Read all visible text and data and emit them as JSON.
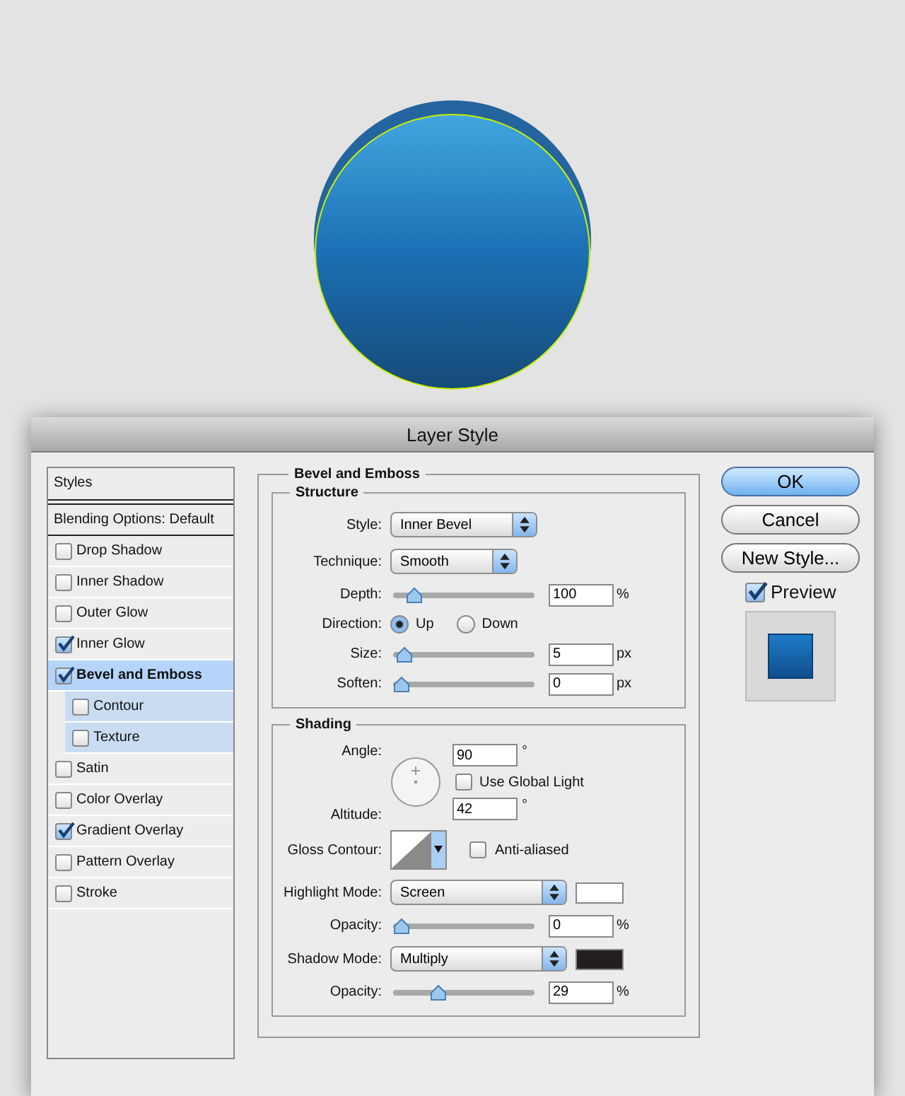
{
  "dialog": {
    "title": "Layer Style"
  },
  "styles": {
    "header": "Styles",
    "blending": "Blending Options: Default",
    "items": [
      {
        "label": "Drop Shadow",
        "checked": false,
        "selected": false
      },
      {
        "label": "Inner Shadow",
        "checked": false,
        "selected": false
      },
      {
        "label": "Outer Glow",
        "checked": false,
        "selected": false
      },
      {
        "label": "Inner Glow",
        "checked": true,
        "selected": false
      },
      {
        "label": "Bevel and Emboss",
        "checked": true,
        "selected": true,
        "children": [
          {
            "label": "Contour",
            "checked": false,
            "selected": false
          },
          {
            "label": "Texture",
            "checked": false,
            "selected": false
          }
        ]
      },
      {
        "label": "Satin",
        "checked": false,
        "selected": false
      },
      {
        "label": "Color Overlay",
        "checked": false,
        "selected": false
      },
      {
        "label": "Gradient Overlay",
        "checked": true,
        "selected": false
      },
      {
        "label": "Pattern Overlay",
        "checked": false,
        "selected": false
      },
      {
        "label": "Stroke",
        "checked": false,
        "selected": false
      }
    ]
  },
  "panel": {
    "title": "Bevel and Emboss",
    "structure": {
      "title": "Structure",
      "rows": [
        {
          "kind": "dropdown",
          "label": "Style:",
          "value": "Inner Bevel"
        },
        {
          "kind": "dropdown",
          "label": "Technique:",
          "value": "Smooth"
        },
        {
          "kind": "slider",
          "label": "Depth:",
          "level": 0.1,
          "value": "100",
          "unit": "%"
        },
        {
          "kind": "radio",
          "label": "Direction:",
          "options": [
            {
              "label": "Up",
              "selected": true
            },
            {
              "label": "Down",
              "selected": false
            }
          ]
        },
        {
          "kind": "slider",
          "label": "Size:",
          "level": 0.02,
          "value": "5",
          "unit": "px"
        },
        {
          "kind": "slider",
          "label": "Soften:",
          "level": 0,
          "value": "0",
          "unit": "px"
        }
      ]
    },
    "shading": {
      "title": "Shading",
      "angle": {
        "label": "Angle:",
        "value": "90",
        "unit": "°"
      },
      "global_light": {
        "label": "Use Global Light",
        "checked": false
      },
      "altitude": {
        "label": "Altitude:",
        "value": "42",
        "unit": "°"
      },
      "gloss": {
        "label": "Gloss Contour:"
      },
      "anti_aliased": {
        "label": "Anti-aliased",
        "checked": false
      },
      "rows": [
        {
          "kind": "dropdown",
          "label": "Highlight Mode:",
          "value": "Screen",
          "color": "#ffffff"
        },
        {
          "kind": "slider",
          "label": "Opacity:",
          "level": 0,
          "value": "0",
          "unit": "%"
        },
        {
          "kind": "dropdown",
          "label": "Shadow Mode:",
          "value": "Multiply",
          "color": "#231f20"
        },
        {
          "kind": "slider",
          "label": "Opacity:",
          "level": 0.29,
          "value": "29",
          "unit": "%"
        }
      ]
    }
  },
  "buttons": [
    {
      "label": "OK",
      "kind": "default"
    },
    {
      "label": "Cancel",
      "kind": "plain"
    },
    {
      "label": "New Style...",
      "kind": "plain"
    }
  ],
  "preview": {
    "label": "Preview",
    "checked": true
  }
}
